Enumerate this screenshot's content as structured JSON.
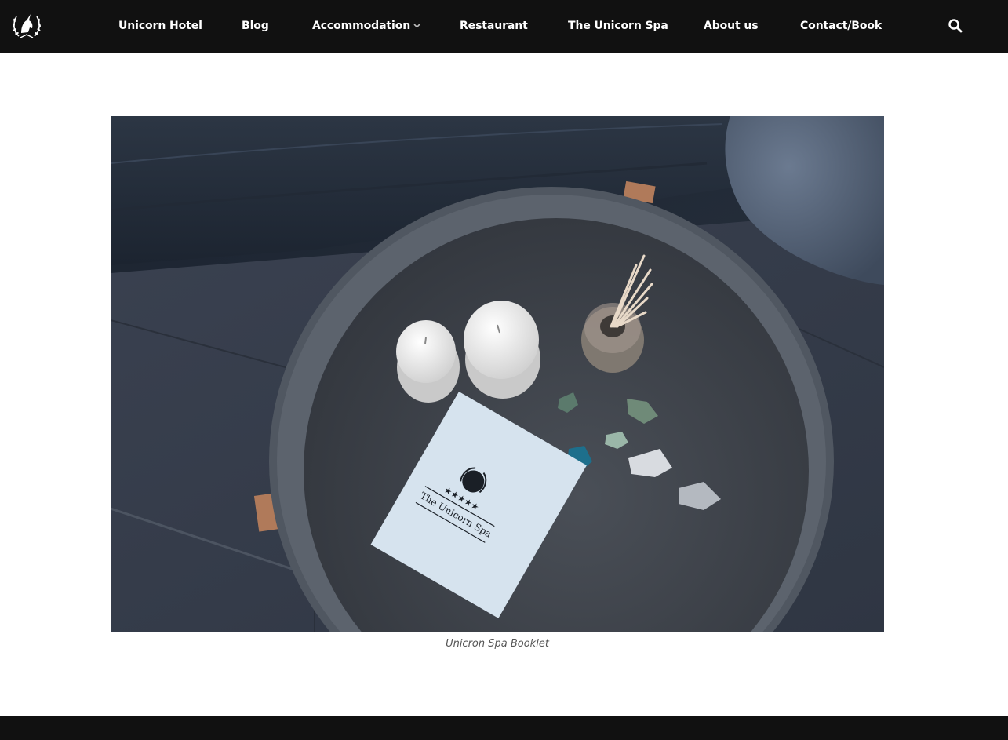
{
  "header": {
    "nav": [
      {
        "label": "Unicorn Hotel"
      },
      {
        "label": "Blog"
      },
      {
        "label": "Accommodation"
      },
      {
        "label": "Restaurant"
      },
      {
        "label": "The Unicorn Spa"
      },
      {
        "label": "About us"
      },
      {
        "label": "Contact/Book"
      }
    ],
    "search_icon": "search-icon",
    "logo_icon": "unicorn-laurel-logo"
  },
  "figure": {
    "caption": "Unicron Spa Booklet",
    "booklet_text": "The Unicorn Spa",
    "booklet_stars": "★★★★★"
  },
  "colors": {
    "header_bg": "#111111",
    "footer_bg": "#111111",
    "nav_text": "#ffffff",
    "caption_text": "#555555"
  }
}
